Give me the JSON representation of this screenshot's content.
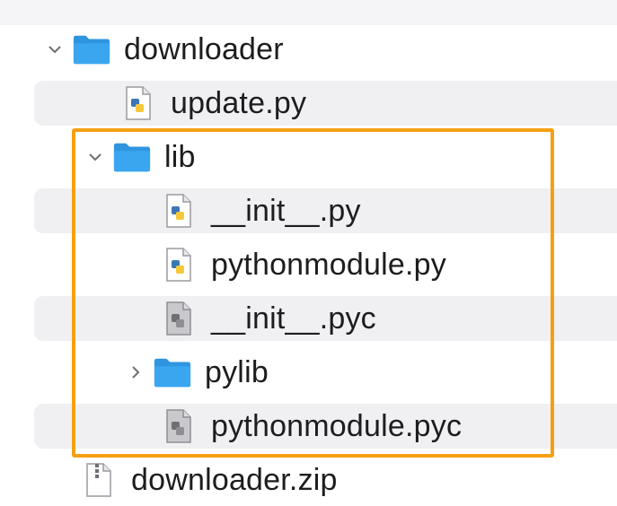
{
  "tree": {
    "items": [
      {
        "label": "downloader",
        "kind": "folder",
        "state": "expanded",
        "striped": false
      },
      {
        "label": "update.py",
        "kind": "python-file",
        "striped": true
      },
      {
        "label": "lib",
        "kind": "folder",
        "state": "expanded",
        "striped": false
      },
      {
        "label": "__init__.py",
        "kind": "python-file",
        "striped": true
      },
      {
        "label": "pythonmodule.py",
        "kind": "python-file",
        "striped": false
      },
      {
        "label": "__init__.pyc",
        "kind": "compiled-file",
        "striped": true
      },
      {
        "label": "pylib",
        "kind": "folder",
        "state": "collapsed",
        "striped": false
      },
      {
        "label": "pythonmodule.pyc",
        "kind": "compiled-file",
        "striped": true
      },
      {
        "label": "downloader.zip",
        "kind": "zip-file",
        "striped": false
      }
    ]
  },
  "colors": {
    "highlight": "#f5a012",
    "folder": "#3aa6f0",
    "stripe": "#f0f0f2"
  },
  "icons": [
    "chevron-down-icon",
    "chevron-right-icon",
    "folder-icon",
    "python-file-icon",
    "compiled-file-icon",
    "zip-file-icon"
  ]
}
